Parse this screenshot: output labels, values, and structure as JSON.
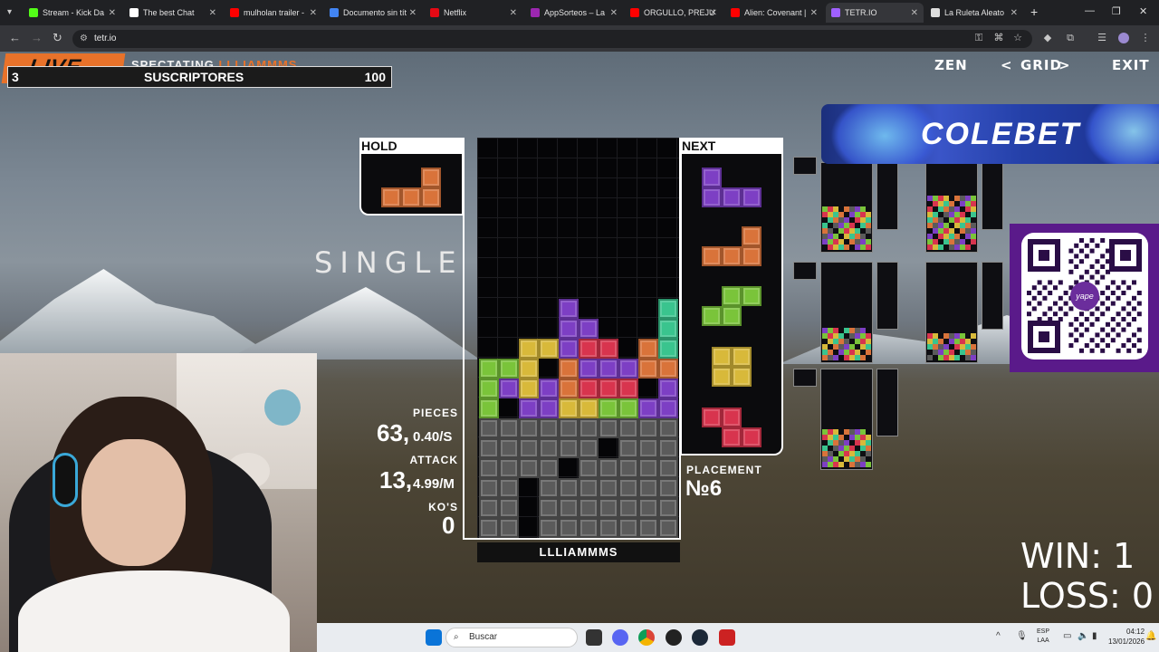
{
  "browser": {
    "tabs": [
      {
        "label": "Stream - Kick Da",
        "color": "#53fc18"
      },
      {
        "label": "The best Chat",
        "color": "#ffffff"
      },
      {
        "label": "mulholan trailer -",
        "color": "#ff0000"
      },
      {
        "label": "Documento sin tít",
        "color": "#4285f4"
      },
      {
        "label": "Netflix",
        "color": "#e50914"
      },
      {
        "label": "AppSorteos – La",
        "color": "#9c27b0"
      },
      {
        "label": "ORGULLO, PREJU",
        "color": "#ff0000"
      },
      {
        "label": "Alien: Covenant |",
        "color": "#ff0000"
      },
      {
        "label": "TETR.IO",
        "color": "#a060ff"
      },
      {
        "label": "La Ruleta Aleato",
        "color": "#dddddd"
      }
    ],
    "url": "tetr.io",
    "new_tab": "+",
    "win_controls": [
      "—",
      "❐",
      "✕"
    ]
  },
  "overlay": {
    "live": "LIVE",
    "subs_count": "3",
    "subs_label": "SUSCRIPTORES",
    "subs_goal": "100",
    "spectating_prefix": "SPECTATING",
    "spectating_user": "LLLIAMMMS"
  },
  "top_nav": {
    "zen": "ZEN",
    "prev": "<",
    "grid": "GRID",
    "next": ">",
    "exit": "EXIT"
  },
  "game": {
    "hold_label": "HOLD",
    "next_label": "NEXT",
    "clear_text": "SINGLE",
    "pieces_label": "PIECES",
    "pieces": "63,",
    "pps": "0.40/S",
    "attack_label": "ATTACK",
    "attack": "13,",
    "apm": "4.99/M",
    "kos_label": "KO'S",
    "kos": "0",
    "placement_label": "PLACEMENT",
    "placement": "№6",
    "username": "LLLIAMMMS"
  },
  "banner": {
    "text": "COLEBET"
  },
  "qr": {
    "brand": "yape"
  },
  "record": {
    "win": "WIN: 1",
    "loss": "LOSS: 0"
  },
  "taskbar": {
    "search_placeholder": "Buscar",
    "lang_top": "ESP",
    "lang_bottom": "LAA",
    "time": "04:12",
    "date": "13/01/2026"
  },
  "colors": {
    "accent": "#e8722a",
    "orange": "#d9733a",
    "purple": "#7d3fc4",
    "green": "#7ac43a",
    "yellow": "#d8b93a",
    "red": "#d8344e",
    "cyan": "#3ac48e",
    "garbage": "#5b5b5b"
  }
}
